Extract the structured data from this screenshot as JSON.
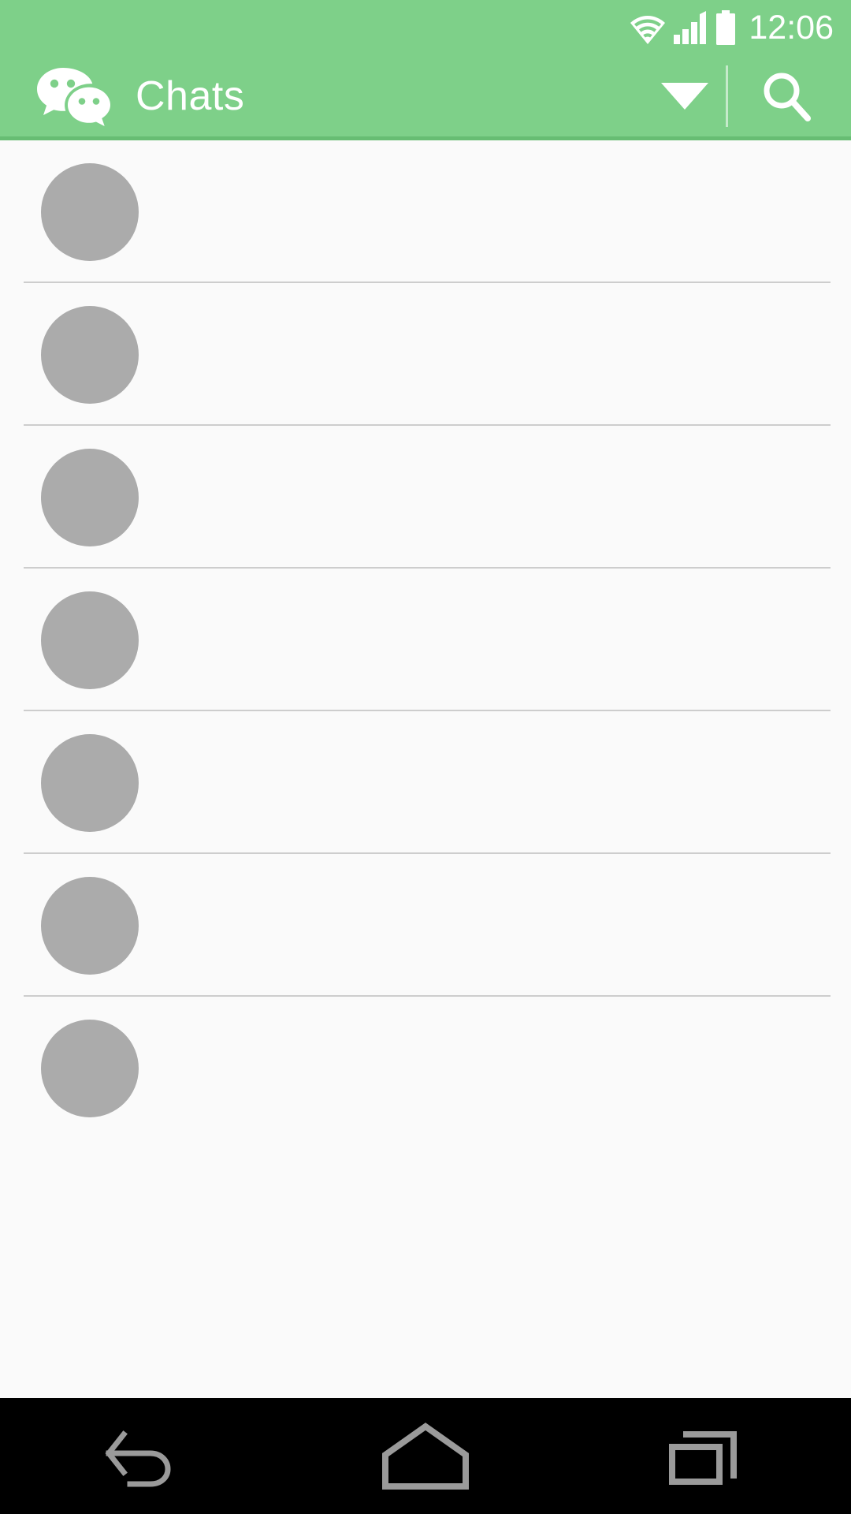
{
  "status_bar": {
    "time": "12:06",
    "icons": [
      "wifi-icon",
      "cellular-signal-icon",
      "battery-icon"
    ],
    "background_color": "#7ED089",
    "foreground_color": "#FFFFFF"
  },
  "toolbar": {
    "logo": "wechat-logo-icon",
    "title": "Chats",
    "dropdown_icon": "chevron-down-icon",
    "search_icon": "search-icon",
    "background_color": "#7ED089",
    "accent_color": "#67BD73",
    "text_color": "#FFFFFF"
  },
  "chat_list": {
    "background_color": "#FAFAFA",
    "avatar_color": "#ABABAB",
    "divider_color": "#CDCDCD",
    "rows": [
      {
        "avatar": "avatar-placeholder",
        "title": "",
        "subtitle": "",
        "timestamp": ""
      },
      {
        "avatar": "avatar-placeholder",
        "title": "",
        "subtitle": "",
        "timestamp": ""
      },
      {
        "avatar": "avatar-placeholder",
        "title": "",
        "subtitle": "",
        "timestamp": ""
      },
      {
        "avatar": "avatar-placeholder",
        "title": "",
        "subtitle": "",
        "timestamp": ""
      },
      {
        "avatar": "avatar-placeholder",
        "title": "",
        "subtitle": "",
        "timestamp": ""
      },
      {
        "avatar": "avatar-placeholder",
        "title": "",
        "subtitle": "",
        "timestamp": ""
      },
      {
        "avatar": "avatar-placeholder",
        "title": "",
        "subtitle": "",
        "timestamp": ""
      }
    ]
  },
  "navigation_bar": {
    "background_color": "#000000",
    "icon_color": "#9A9A9A",
    "buttons": [
      {
        "name": "back-icon"
      },
      {
        "name": "home-icon"
      },
      {
        "name": "recents-icon"
      }
    ]
  }
}
